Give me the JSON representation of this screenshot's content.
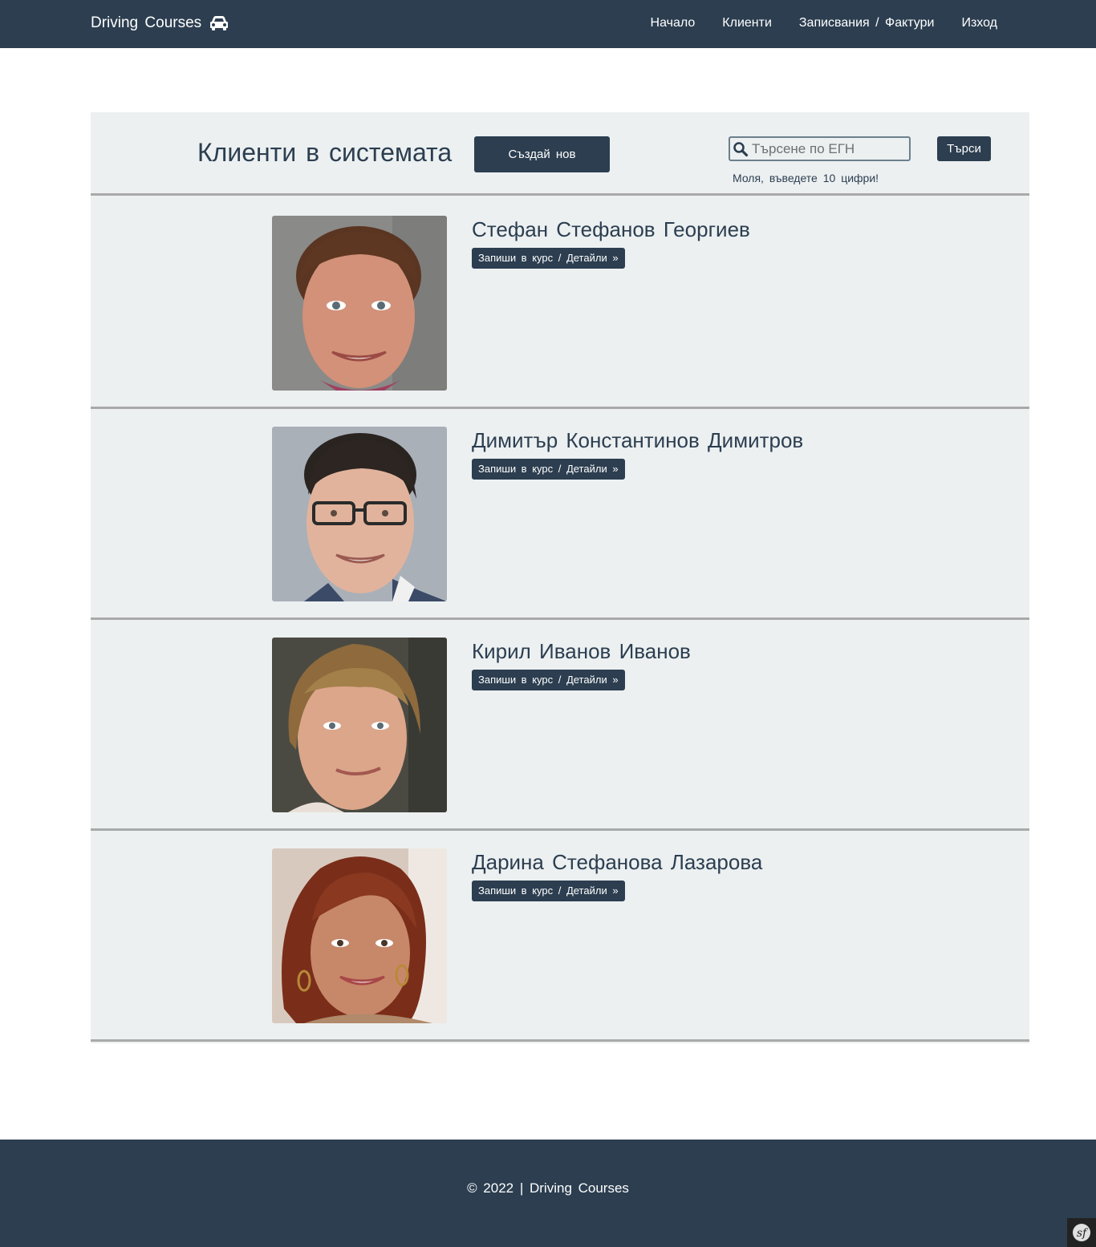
{
  "navbar": {
    "brand": "Driving Courses",
    "brand_icon": "car-icon",
    "links": [
      "Начало",
      "Клиенти",
      "Записвания / Фактури",
      "Изход"
    ]
  },
  "header": {
    "title": "Клиенти в системата",
    "create_button": "Създай нов",
    "search_placeholder": "Търсене по ЕГН",
    "search_button": "Търси",
    "hint": "Моля, въведете 10 цифри!"
  },
  "clients": [
    {
      "name": "Стефан Стефанов Георгиев",
      "action": "Запиши в курс / Детайли »"
    },
    {
      "name": "Димитър Константинов Димитров",
      "action": "Запиши в курс / Детайли »"
    },
    {
      "name": "Кирил Иванов Иванов",
      "action": "Запиши в курс / Детайли »"
    },
    {
      "name": "Дарина Стефанова Лазарова",
      "action": "Запиши в курс / Детайли »"
    }
  ],
  "footer": {
    "text": "© 2022 | Driving Courses"
  },
  "colors": {
    "primary": "#2c3e50",
    "panel": "#ecf0f1",
    "divider": "#a9a9a9"
  }
}
